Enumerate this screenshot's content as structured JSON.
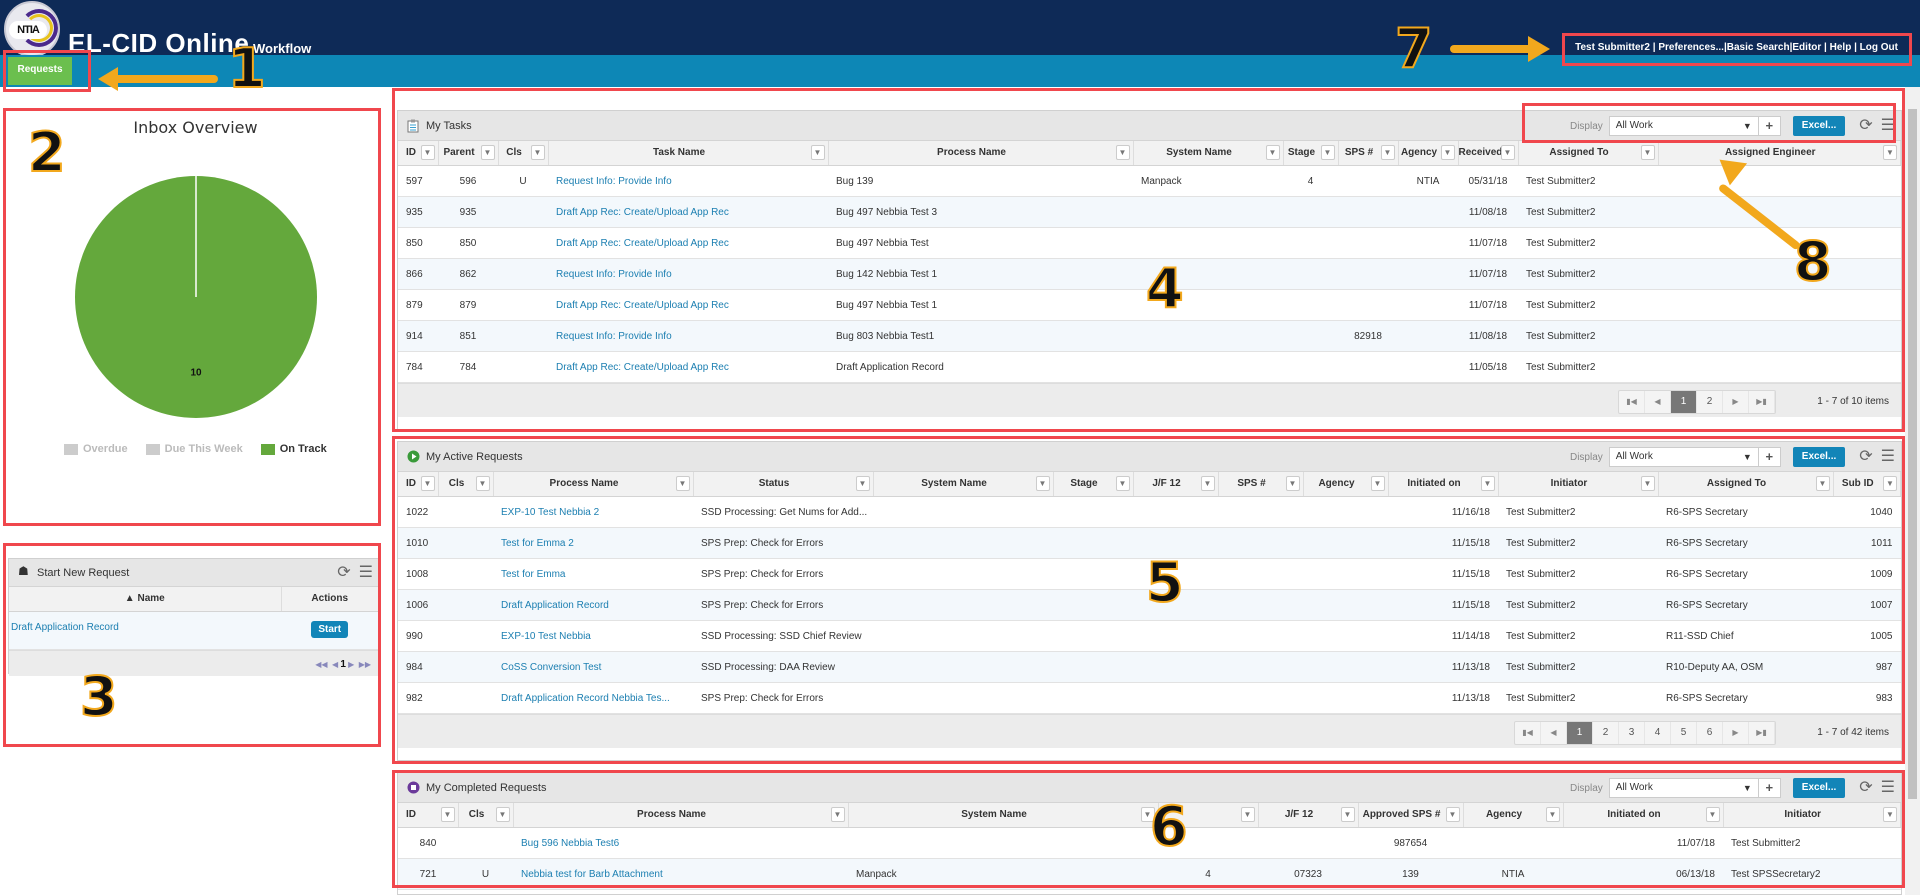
{
  "header": {
    "logo_text": "NTIA",
    "app_title": "EL-CID Online",
    "app_subtitle": "Workflow",
    "user_links": [
      "Test Submitter2",
      "Preferences...",
      "Basic Search",
      "Editor",
      "Help",
      "Log Out"
    ],
    "nav_tab": "Requests"
  },
  "annotations": [
    "1",
    "2",
    "3",
    "4",
    "5",
    "6",
    "7",
    "8"
  ],
  "inbox_overview": {
    "title": "Inbox Overview",
    "chart_data": {
      "type": "pie",
      "title": "Inbox Overview",
      "categories": [
        "Overdue",
        "Due This Week",
        "On Track"
      ],
      "values": [
        0,
        0,
        10
      ],
      "colors": [
        "#cccccc",
        "#cccccc",
        "#64a83c"
      ],
      "data_labels": [
        "",
        "",
        "10"
      ],
      "legend": "bottom"
    }
  },
  "start_new_request": {
    "title": "Start New Request",
    "columns": [
      "Name",
      "Actions"
    ],
    "rows": [
      {
        "name": "Draft Application Record",
        "action": "Start"
      }
    ],
    "pager": {
      "current": "1"
    }
  },
  "my_tasks": {
    "title": "My Tasks",
    "display_label": "Display",
    "display_value": "All Work",
    "excel_label": "Excel...",
    "columns": [
      "ID",
      "Parent",
      "Cls",
      "Task Name",
      "Process Name",
      "System Name",
      "Stage",
      "SPS #",
      "Agency",
      "Received",
      "Assigned To",
      "Assigned Engineer"
    ],
    "rows": [
      [
        "597",
        "596",
        "U",
        "Request Info: Provide Info",
        "Bug 139",
        "Manpack",
        "4",
        "",
        "NTIA",
        "05/31/18",
        "Test Submitter2",
        ""
      ],
      [
        "935",
        "935",
        "",
        "Draft App Rec: Create/Upload App Rec",
        "Bug 497 Nebbia Test 3",
        "",
        "",
        "",
        "",
        "11/08/18",
        "Test Submitter2",
        ""
      ],
      [
        "850",
        "850",
        "",
        "Draft App Rec: Create/Upload App Rec",
        "Bug 497 Nebbia Test",
        "",
        "",
        "",
        "",
        "11/07/18",
        "Test Submitter2",
        ""
      ],
      [
        "866",
        "862",
        "",
        "Request Info: Provide Info",
        "Bug 142 Nebbia Test 1",
        "",
        "",
        "",
        "",
        "11/07/18",
        "Test Submitter2",
        ""
      ],
      [
        "879",
        "879",
        "",
        "Draft App Rec: Create/Upload App Rec",
        "Bug 497 Nebbia Test 1",
        "",
        "",
        "",
        "",
        "11/07/18",
        "Test Submitter2",
        ""
      ],
      [
        "914",
        "851",
        "",
        "Request Info: Provide Info",
        "Bug 803 Nebbia Test1",
        "",
        "",
        "82918",
        "",
        "11/08/18",
        "Test Submitter2",
        ""
      ],
      [
        "784",
        "784",
        "",
        "Draft App Rec: Create/Upload App Rec",
        "Draft Application Record",
        "",
        "",
        "",
        "",
        "11/05/18",
        "Test Submitter2",
        ""
      ]
    ],
    "pages": [
      "1",
      "2"
    ],
    "current_page": "1",
    "pager_info": "1 - 7 of 10 items"
  },
  "my_active_requests": {
    "title": "My Active Requests",
    "display_label": "Display",
    "display_value": "All Work",
    "excel_label": "Excel...",
    "columns": [
      "ID",
      "Cls",
      "Process Name",
      "Status",
      "System Name",
      "Stage",
      "J/F 12",
      "SPS #",
      "Agency",
      "Initiated on",
      "Initiator",
      "Assigned To",
      "Sub ID"
    ],
    "rows": [
      [
        "1022",
        "",
        "EXP-10 Test Nebbia 2",
        "SSD Processing: Get Nums for Add...",
        "",
        "",
        "",
        "",
        "",
        "11/16/18",
        "Test Submitter2",
        "R6-SPS Secretary",
        "1040"
      ],
      [
        "1010",
        "",
        "Test for Emma 2",
        "SPS Prep: Check for Errors",
        "",
        "",
        "",
        "",
        "",
        "11/15/18",
        "Test Submitter2",
        "R6-SPS Secretary",
        "1011"
      ],
      [
        "1008",
        "",
        "Test for Emma",
        "SPS Prep: Check for Errors",
        "",
        "",
        "",
        "",
        "",
        "11/15/18",
        "Test Submitter2",
        "R6-SPS Secretary",
        "1009"
      ],
      [
        "1006",
        "",
        "Draft Application Record",
        "SPS Prep: Check for Errors",
        "",
        "",
        "",
        "",
        "",
        "11/15/18",
        "Test Submitter2",
        "R6-SPS Secretary",
        "1007"
      ],
      [
        "990",
        "",
        "EXP-10 Test Nebbia",
        "SSD Processing: SSD Chief Review",
        "",
        "",
        "",
        "",
        "",
        "11/14/18",
        "Test Submitter2",
        "R11-SSD Chief",
        "1005"
      ],
      [
        "984",
        "",
        "CoSS Conversion Test",
        "SSD Processing: DAA Review",
        "",
        "",
        "",
        "",
        "",
        "11/13/18",
        "Test Submitter2",
        "R10-Deputy AA, OSM",
        "987"
      ],
      [
        "982",
        "",
        "Draft Application Record Nebbia Tes...",
        "SPS Prep: Check for Errors",
        "",
        "",
        "",
        "",
        "",
        "11/13/18",
        "Test Submitter2",
        "R6-SPS Secretary",
        "983"
      ]
    ],
    "pages": [
      "1",
      "2",
      "3",
      "4",
      "5",
      "6"
    ],
    "current_page": "1",
    "pager_info": "1 - 7 of 42 items"
  },
  "my_completed_requests": {
    "title": "My Completed Requests",
    "display_label": "Display",
    "display_value": "All Work",
    "excel_label": "Excel...",
    "columns": [
      "ID",
      "Cls",
      "Process Name",
      "System Name",
      "",
      "J/F 12",
      "Approved SPS #",
      "Agency",
      "Initiated on",
      "Initiator"
    ],
    "rows": [
      [
        "840",
        "",
        "Bug 596 Nebbia Test6",
        "",
        "",
        "",
        "987654",
        "",
        "11/07/18",
        "Test Submitter2"
      ],
      [
        "721",
        "U",
        "Nebbia test for Barb Attachment",
        "Manpack",
        "4",
        "07323",
        "139",
        "NTIA",
        "06/13/18",
        "Test SPSSecretary2"
      ]
    ]
  }
}
